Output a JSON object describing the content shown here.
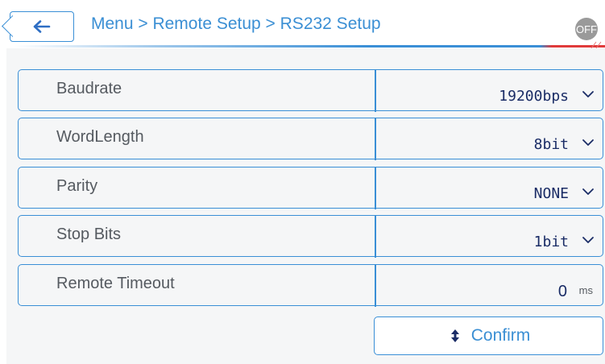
{
  "header": {
    "breadcrumb": "Menu > Remote Setup > RS232 Setup",
    "status_badge": "OFF",
    "back_icon": "left-arrow-icon"
  },
  "settings": [
    {
      "label": "Baudrate",
      "value": "19200bps",
      "control": "dropdown"
    },
    {
      "label": "WordLength",
      "value": "8bit",
      "control": "dropdown"
    },
    {
      "label": "Parity",
      "value": "NONE",
      "control": "dropdown"
    },
    {
      "label": "Stop Bits",
      "value": "1bit",
      "control": "dropdown"
    }
  ],
  "timeout": {
    "label": "Remote Timeout",
    "value": "0",
    "unit": "ms"
  },
  "confirm": {
    "label": "Confirm",
    "icon": "sync-icon"
  },
  "colors": {
    "accent": "#3a8fd6",
    "value_text": "#1a2c66",
    "label_text": "#555a60",
    "badge_off": "#9a9a9a",
    "alert_line": "#e03a3a"
  }
}
